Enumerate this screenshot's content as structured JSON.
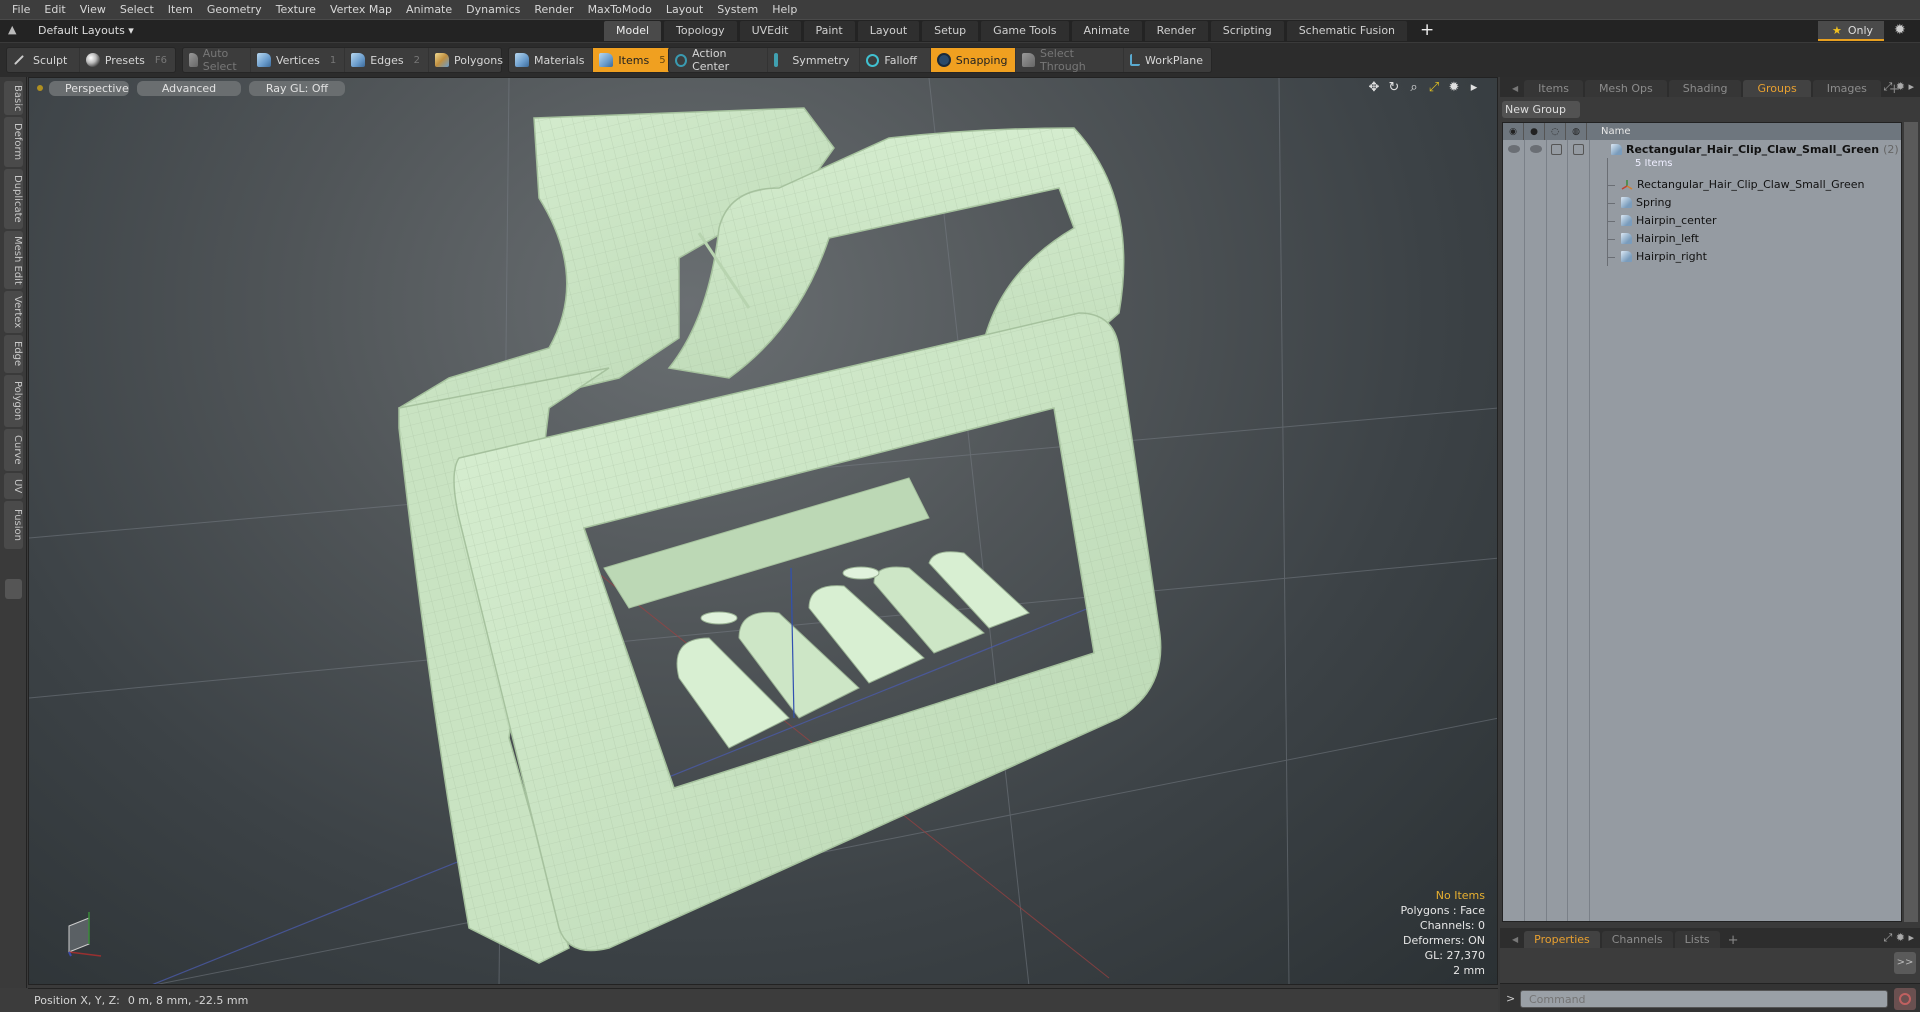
{
  "menu": [
    "File",
    "Edit",
    "View",
    "Select",
    "Item",
    "Geometry",
    "Texture",
    "Vertex Map",
    "Animate",
    "Dynamics",
    "Render",
    "MaxToModo",
    "Layout",
    "System",
    "Help"
  ],
  "layout_bar": {
    "layout_selector": "Default Layouts ▾",
    "tabs": [
      {
        "label": "Model",
        "active": true
      },
      {
        "label": "Topology"
      },
      {
        "label": "UVEdit"
      },
      {
        "label": "Paint"
      },
      {
        "label": "Layout"
      },
      {
        "label": "Setup"
      },
      {
        "label": "Game Tools"
      },
      {
        "label": "Animate"
      },
      {
        "label": "Render"
      },
      {
        "label": "Scripting"
      },
      {
        "label": "Schematic Fusion"
      }
    ],
    "add_tab": "+",
    "only_label": "Only",
    "only_icon": "★"
  },
  "toolbar": {
    "sculpt": "Sculpt",
    "presets": "Presets",
    "presets_key": "F6",
    "auto_select": "Auto Select",
    "vertices": "Vertices",
    "vertices_key": "1",
    "edges": "Edges",
    "edges_key": "2",
    "polygons": "Polygons",
    "materials": "Materials",
    "items": "Items",
    "items_key": "5",
    "action_center": "Action Center",
    "symmetry": "Symmetry",
    "falloff": "Falloff",
    "snapping": "Snapping",
    "select_through": "Select Through",
    "workplane": "WorkPlane",
    "active_color": "#f0a020"
  },
  "left_tabs": [
    "Basic",
    "Deform",
    "Duplicate",
    "Mesh Edit",
    "Vertex",
    "Edge",
    "Polygon",
    "Curve",
    "UV",
    "Fusion"
  ],
  "viewport": {
    "view_mode": "Perspective",
    "shading": "Advanced",
    "raygl": "Ray GL: Off",
    "hud": {
      "selection": "No Items",
      "polygons": "Polygons : Face",
      "channels": "Channels: 0",
      "deformers": "Deformers: ON",
      "gl": "GL: 27,370",
      "grid": "2 mm"
    },
    "model_color": "#cfe8c8"
  },
  "right_panel": {
    "tabs": [
      {
        "label": "Items"
      },
      {
        "label": "Mesh Ops"
      },
      {
        "label": "Shading"
      },
      {
        "label": "Groups",
        "active": true
      },
      {
        "label": "Images"
      }
    ],
    "new_group": "New Group",
    "column_name": "Name",
    "group": {
      "name": "Rectangular_Hair_Clip_Claw_Small_Green",
      "count": "(2)",
      "ellipsis": "...",
      "sub": "5 Items",
      "children": [
        {
          "name": "Rectangular_Hair_Clip_Claw_Small_Green",
          "icon": "locator"
        },
        {
          "name": "Spring",
          "icon": "mesh"
        },
        {
          "name": "Hairpin_center",
          "icon": "mesh"
        },
        {
          "name": "Hairpin_left",
          "icon": "mesh"
        },
        {
          "name": "Hairpin_right",
          "icon": "mesh"
        }
      ]
    },
    "bottom_tabs": [
      {
        "label": "Properties",
        "active": true
      },
      {
        "label": "Channels"
      },
      {
        "label": "Lists"
      }
    ],
    "expand_label": ">>",
    "command_placeholder": "Command",
    "prompt": ">"
  },
  "status": {
    "position_label": "Position X, Y, Z:",
    "position_value": "0 m, 8 mm, -22.5 mm"
  }
}
